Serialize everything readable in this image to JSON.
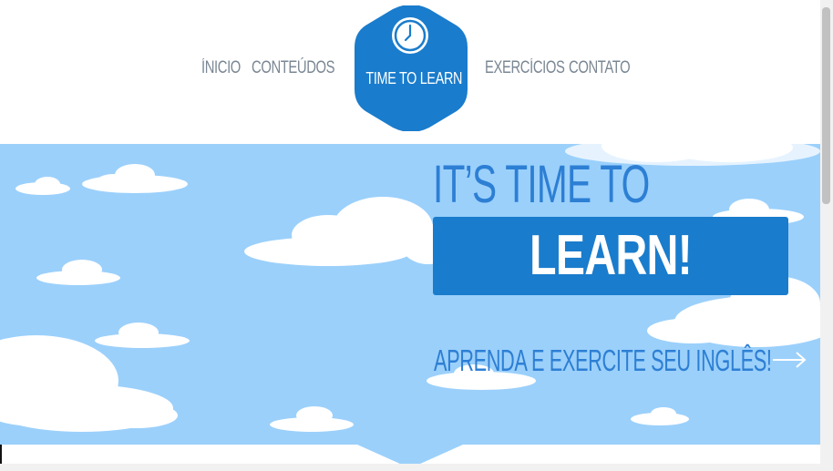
{
  "nav": {
    "items": [
      {
        "label": "ÍNICIO"
      },
      {
        "label": "CONTEÚDOS"
      },
      {
        "label": "EXERCÍCIOS"
      },
      {
        "label": "CONTATO"
      }
    ],
    "logo": {
      "text": "TIME TO LEARN",
      "icon": "clock-icon"
    }
  },
  "hero": {
    "headline": "IT’S TIME TO",
    "highlight": "LEARN!",
    "tagline": "APRENDA E EXERCITE SEU INGLÊS!",
    "arrow_icon": "arrow-right-icon"
  },
  "colors": {
    "brand_blue": "#1a7ccc",
    "sky": "#9bd0fb",
    "heading_blue": "#2d7fd4",
    "nav_gray": "#7a8794"
  }
}
